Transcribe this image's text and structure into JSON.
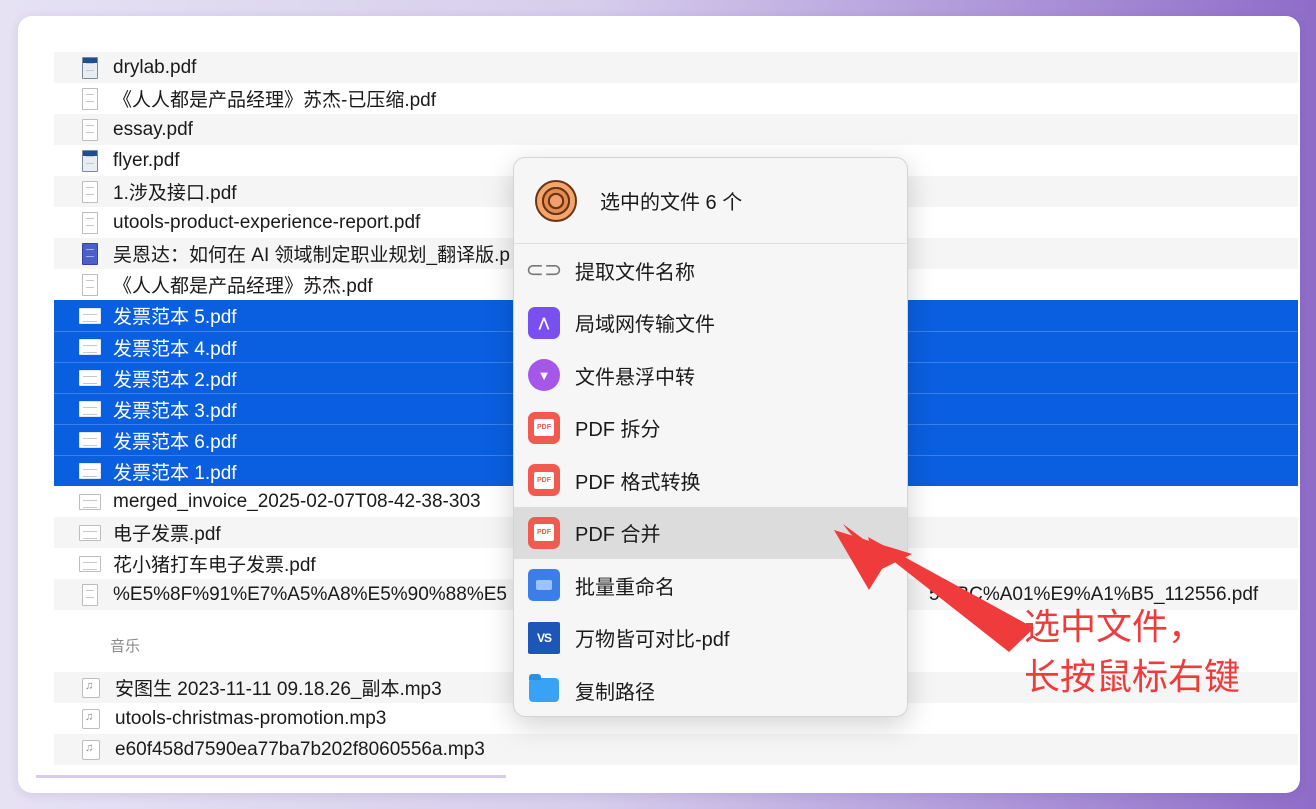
{
  "files": [
    {
      "name": "drylab.pdf",
      "icon": "pdf-file-icon-dark",
      "alt": true,
      "selected": false
    },
    {
      "name": "《人人都是产品经理》苏杰-已压缩.pdf",
      "icon": "pdf-file-icon",
      "alt": false,
      "selected": false
    },
    {
      "name": "essay.pdf",
      "icon": "pdf-file-icon",
      "alt": true,
      "selected": false
    },
    {
      "name": "flyer.pdf",
      "icon": "pdf-file-icon",
      "alt": false,
      "selected": false
    },
    {
      "name": "1.涉及接口.pdf",
      "icon": "pdf-file-icon",
      "alt": true,
      "selected": false
    },
    {
      "name": "utools-product-experience-report.pdf",
      "icon": "pdf-file-icon",
      "alt": false,
      "selected": false
    },
    {
      "name": "吴恩达：如何在 AI 领域制定职业规划_翻译版.p",
      "icon": "pdf-file-icon-blue",
      "alt": true,
      "selected": false
    },
    {
      "name": "《人人都是产品经理》苏杰.pdf",
      "icon": "pdf-file-icon",
      "alt": false,
      "selected": false
    },
    {
      "name": "发票范本 5.pdf",
      "icon": "invoice-file-icon",
      "alt": false,
      "selected": true
    },
    {
      "name": "发票范本 4.pdf",
      "icon": "invoice-file-icon",
      "alt": false,
      "selected": true
    },
    {
      "name": "发票范本 2.pdf",
      "icon": "invoice-file-icon",
      "alt": false,
      "selected": true
    },
    {
      "name": "发票范本 3.pdf",
      "icon": "invoice-file-icon",
      "alt": false,
      "selected": true
    },
    {
      "name": "发票范本 6.pdf",
      "icon": "invoice-file-icon",
      "alt": false,
      "selected": true
    },
    {
      "name": "发票范本 1.pdf",
      "icon": "invoice-file-icon",
      "alt": false,
      "selected": true
    },
    {
      "name": "merged_invoice_2025-02-07T08-42-38-303",
      "icon": "invoice-file-icon",
      "alt": false,
      "selected": false
    },
    {
      "name": "电子发票.pdf",
      "icon": "invoice-file-icon",
      "alt": true,
      "selected": false
    },
    {
      "name": "花小猪打车电子发票.pdf",
      "icon": "invoice-file-icon",
      "alt": false,
      "selected": false
    },
    {
      "name": "%E5%8F%91%E7%A5%A8%E5%90%88%E5",
      "icon": "pdf-file-icon",
      "alt": true,
      "selected": false,
      "tail": "5%BC%A01%E9%A1%B5_112556.pdf"
    }
  ],
  "music_section": {
    "label": "音乐",
    "files": [
      {
        "name": "安图生 2023-11-11 09.18.26_副本.mp3",
        "alt": true
      },
      {
        "name": "utools-christmas-promotion.mp3",
        "alt": false
      },
      {
        "name": "e60f458d7590ea77ba7b202f8060556a.mp3",
        "alt": true
      }
    ]
  },
  "context_menu": {
    "header": "选中的文件 6 个",
    "items": [
      {
        "label": "提取文件名称",
        "icon": "link-icon",
        "highlighted": false
      },
      {
        "label": "局域网传输文件",
        "icon": "lan-transfer-icon",
        "highlighted": false
      },
      {
        "label": "文件悬浮中转",
        "icon": "pin-icon",
        "highlighted": false
      },
      {
        "label": "PDF 拆分",
        "icon": "pdf-icon",
        "highlighted": false
      },
      {
        "label": "PDF 格式转换",
        "icon": "pdf-icon",
        "highlighted": false
      },
      {
        "label": "PDF 合并",
        "icon": "pdf-icon",
        "highlighted": true
      },
      {
        "label": "批量重命名",
        "icon": "rename-icon",
        "highlighted": false
      },
      {
        "label": "万物皆可对比-pdf",
        "icon": "vs-compare-icon",
        "highlighted": false
      },
      {
        "label": "复制路径",
        "icon": "folder-icon",
        "highlighted": false
      }
    ]
  },
  "annotation": {
    "line1": "选中文件，",
    "line2": "长按鼠标右键",
    "color": "#ef3b3b"
  },
  "colors": {
    "selection": "#0a5fe0",
    "menu_highlight": "#dcdcdc"
  }
}
